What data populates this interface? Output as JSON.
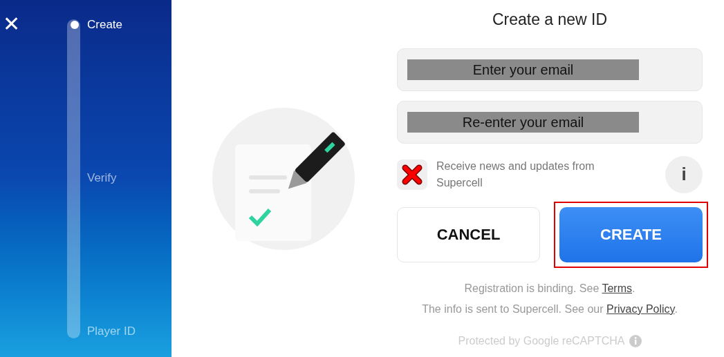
{
  "sidebar": {
    "close": "✕",
    "steps": [
      {
        "label": "Create",
        "selected": true
      },
      {
        "label": "Verify",
        "selected": false
      },
      {
        "label": "Player ID",
        "selected": false
      }
    ]
  },
  "form": {
    "title": "Create a new ID",
    "fields": [
      {
        "placeholder": "Enter your email"
      },
      {
        "placeholder": "Re-enter your email"
      }
    ],
    "newsletter": {
      "label": "Receive news and updates from Supercell",
      "checked": false,
      "info": "i"
    },
    "buttons": [
      {
        "label": "CANCEL",
        "kind": "secondary",
        "highlighted": false
      },
      {
        "label": "CREATE",
        "kind": "primary",
        "highlighted": true
      }
    ],
    "notes": [
      {
        "text": "Registration is binding. See ",
        "link": "Terms",
        "after": "."
      },
      {
        "text": "The info is sent to Supercell. See our ",
        "link": "Privacy Policy",
        "after": "."
      }
    ],
    "recaptcha": "Protected by Google reCAPTCHA"
  }
}
